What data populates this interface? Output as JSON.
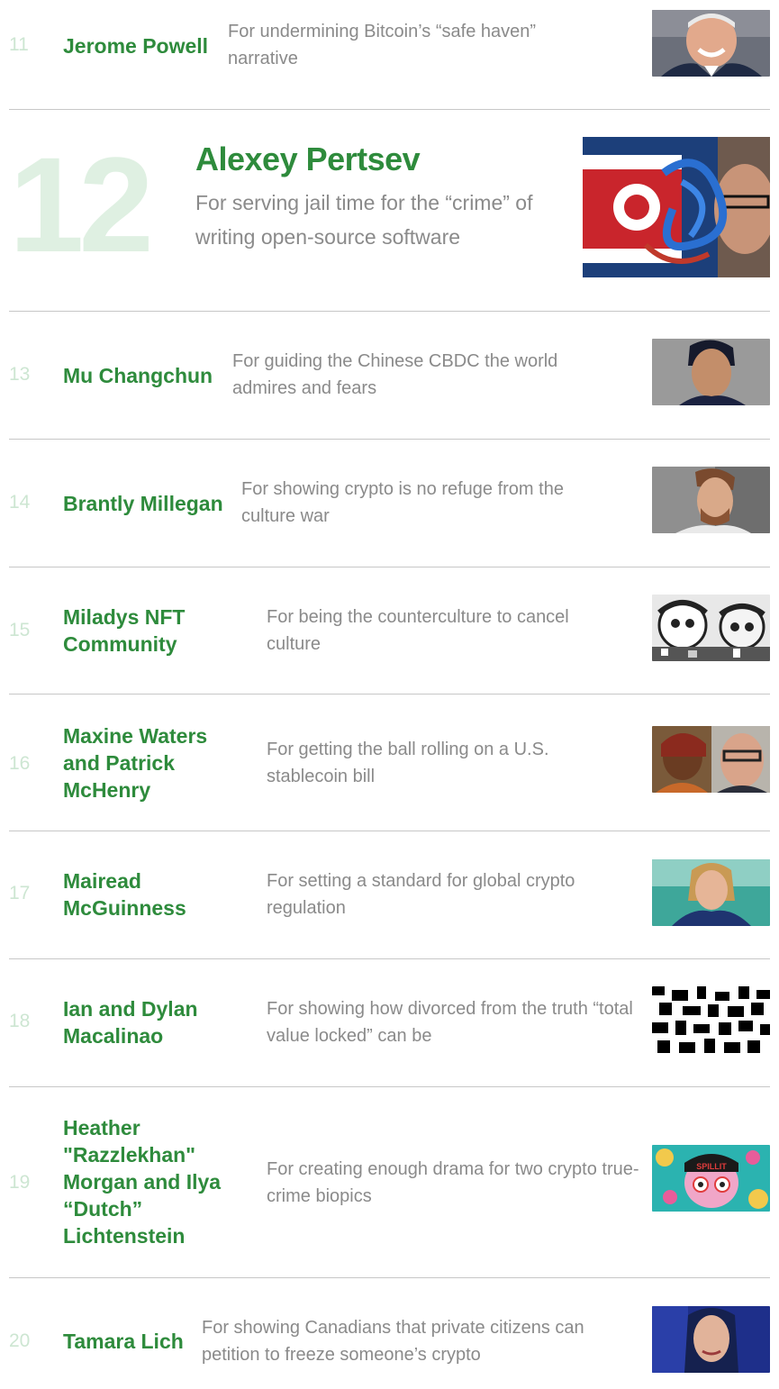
{
  "entries": [
    {
      "rank": "11",
      "name": "Jerome Powell",
      "desc": "For undermining Bitcoin’s “safe haven” narrative",
      "image": "jerome-powell-portrait"
    },
    {
      "rank": "12",
      "name": "Alexey Pertsev",
      "desc": "For serving jail time for the “crime” of writing open-source software",
      "image": "alexey-pertsev-portrait"
    },
    {
      "rank": "13",
      "name": "Mu Changchun",
      "desc": "For guiding the Chinese CBDC the world admires and fears",
      "image": "mu-changchun-portrait"
    },
    {
      "rank": "14",
      "name": "Brantly Millegan",
      "desc": "For showing crypto is no refuge from the culture war",
      "image": "brantly-millegan-portrait"
    },
    {
      "rank": "15",
      "name": "Miladys NFT Community",
      "desc": "For being the counterculture to cancel culture",
      "image": "miladys-nft-art"
    },
    {
      "rank": "16",
      "name": "Maxine Waters and Patrick McHenry",
      "desc": "For getting the ball rolling on a U.S. stablecoin bill",
      "image": "waters-mchenry-portrait"
    },
    {
      "rank": "17",
      "name": "Mairead McGuinness",
      "desc": "For setting a standard for global crypto regulation",
      "image": "mairead-mcguinness-portrait"
    },
    {
      "rank": "18",
      "name": "Ian and Dylan Macalinao",
      "desc": "For showing how divorced from the truth “total value locked” can be",
      "image": "macalinao-pixel-art"
    },
    {
      "rank": "19",
      "name": "Heather \"Razzlekhan\" Morgan and Ilya “Dutch” Lichtenstein",
      "desc": "For creating enough drama for two crypto true-crime biopics",
      "image": "razzlekhan-art"
    },
    {
      "rank": "20",
      "name": "Tamara Lich",
      "desc": "For showing Canadians that private citizens can petition to freeze someone’s crypto",
      "image": "tamara-lich-portrait"
    }
  ]
}
